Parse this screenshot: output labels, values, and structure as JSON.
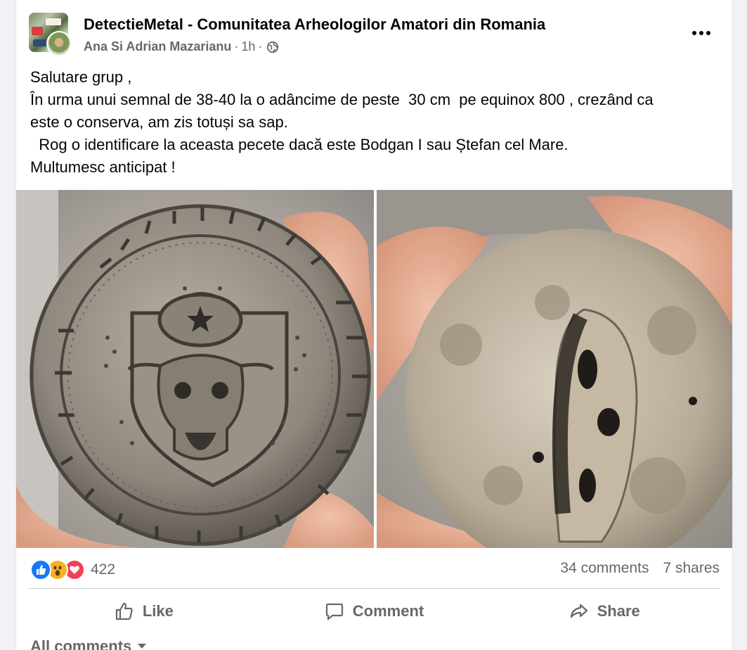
{
  "post": {
    "group_name": "DetectieMetal - Comunitatea Arheologilor Amatori din Romania",
    "author": "Ana Si Adrian Mazarianu",
    "separator": "·",
    "time": "1h",
    "privacy_icon": "globe-icon",
    "more_icon": "more-options-icon",
    "text_lines": [
      "Salutare grup ,",
      "În urma unui semnal de 38-40 la o adâncime de peste  30 cm  pe equinox 800 , crezând ca",
      "este o conserva, am zis totuși sa sap.",
      "  Rog o identificare la aceasta pecete dacă este Bodgan I sau Ștefan cel Mare.",
      "Multumesc anticipat !"
    ],
    "photos": [
      {
        "name": "seal-front-photo",
        "description_icon": "photo"
      },
      {
        "name": "seal-back-photo",
        "description_icon": "photo"
      }
    ]
  },
  "reactions": {
    "icons": [
      "like-reaction-icon",
      "wow-reaction-icon",
      "love-reaction-icon"
    ],
    "count": "422",
    "comments": "34 comments",
    "shares": "7 shares"
  },
  "actions": {
    "like": "Like",
    "comment": "Comment",
    "share": "Share"
  },
  "comments_filter": {
    "label": "All comments"
  },
  "colors": {
    "primary_text": "#050505",
    "secondary_text": "#65676b",
    "like_blue": "#1877f2",
    "love_red": "#f33e58",
    "wow_yellow": "#f7b125",
    "divider": "#ced0d4",
    "page_bg": "#f0f2f5"
  }
}
